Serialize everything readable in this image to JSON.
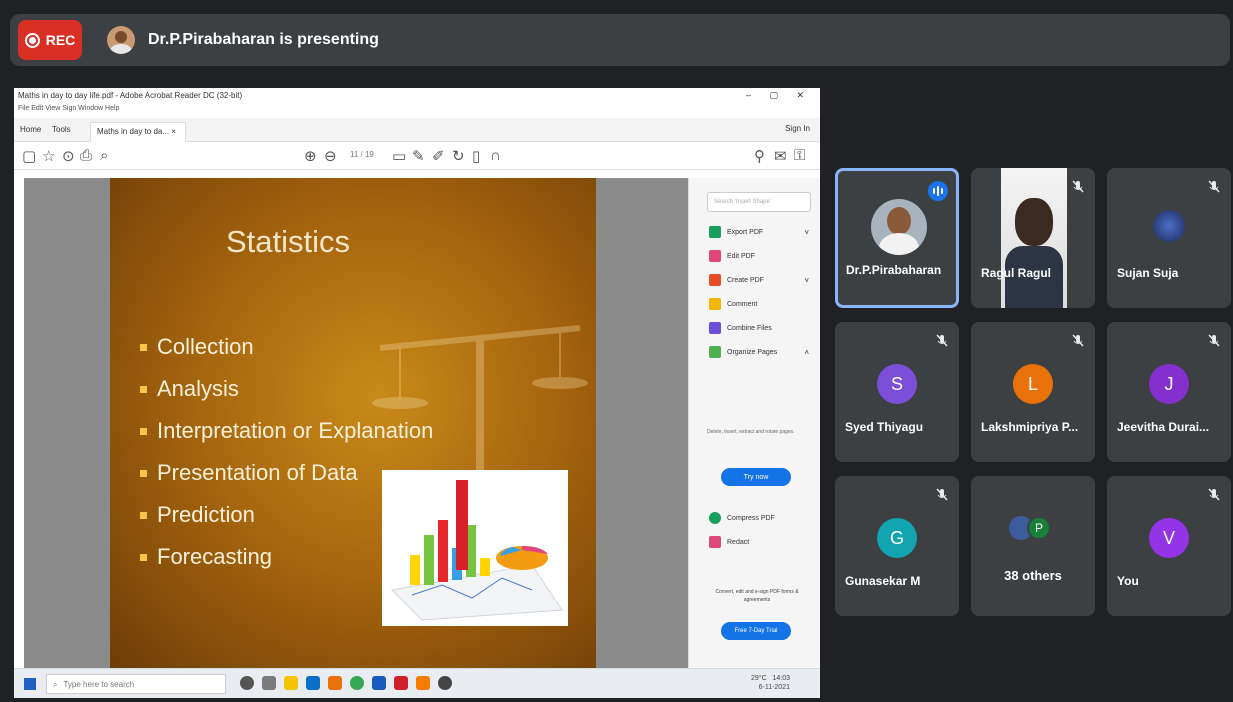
{
  "meeting": {
    "rec_label": "REC",
    "presenting_text": "Dr.P.Pirabaharan is presenting"
  },
  "acrobat": {
    "window_title": "Maths in day to day life.pdf - Adobe Acrobat Reader DC (32-bit)",
    "menu": "File  Edit  View  Sign  Window  Help",
    "tabs": [
      "Home",
      "Tools"
    ],
    "doc_tab": "Maths in day to da... ×",
    "sign_in": "Sign In",
    "page_count": "11 / 19",
    "panel_search": "Search 'Insert Shape'",
    "tools": [
      {
        "label": "Export PDF",
        "color": "#1a9e5c",
        "chevron": "˅"
      },
      {
        "label": "Edit PDF",
        "color": "#e0457b",
        "chevron": ""
      },
      {
        "label": "Create PDF",
        "color": "#e44d26",
        "chevron": "˅"
      },
      {
        "label": "Comment",
        "color": "#f2b705",
        "chevron": ""
      },
      {
        "label": "Combine Files",
        "color": "#6b4fd8",
        "chevron": ""
      },
      {
        "label": "Organize Pages",
        "color": "#4caf50",
        "chevron": "˄"
      }
    ],
    "panel_desc": "Delete, insert, extract and rotate pages.",
    "try_now": "Try now",
    "tools_lower": [
      {
        "label": "Compress PDF",
        "color": "#1a9e5c"
      },
      {
        "label": "Redact",
        "color": "#e0457b"
      }
    ],
    "panel_foot": "Convert, edit and e-sign PDF forms & agreements",
    "free_trial": "Free 7-Day Trial"
  },
  "slide": {
    "title": "Statistics",
    "bullets": [
      "Collection",
      "Analysis",
      "Interpretation or Explanation",
      "Presentation of Data",
      "Prediction",
      "Forecasting"
    ]
  },
  "taskbar": {
    "search_placeholder": "Type here to search",
    "time": "14:03",
    "date": "6-11-2021",
    "weather": "29°C"
  },
  "participants": [
    {
      "name": "Dr.P.Pirabaharan",
      "type": "photo",
      "speaking": true
    },
    {
      "name": "Ragul Ragul",
      "type": "video",
      "muted": true
    },
    {
      "name": "Sujan Suja",
      "type": "image-avatar",
      "muted": true
    },
    {
      "name": "Syed Thiyagu",
      "initial": "S",
      "color": "#7b4fd8",
      "muted": true
    },
    {
      "name": "Lakshmipriya P...",
      "initial": "L",
      "color": "#e8710a",
      "muted": true
    },
    {
      "name": "Jeevitha Durai...",
      "initial": "J",
      "color": "#8430ce",
      "muted": true
    },
    {
      "name": "Gunasekar M",
      "initial": "G",
      "color": "#12a4af",
      "muted": true
    },
    {
      "name": "38 others",
      "type": "others",
      "initial": "P"
    },
    {
      "name": "You",
      "initial": "V",
      "color": "#9334e6",
      "muted": true
    }
  ]
}
